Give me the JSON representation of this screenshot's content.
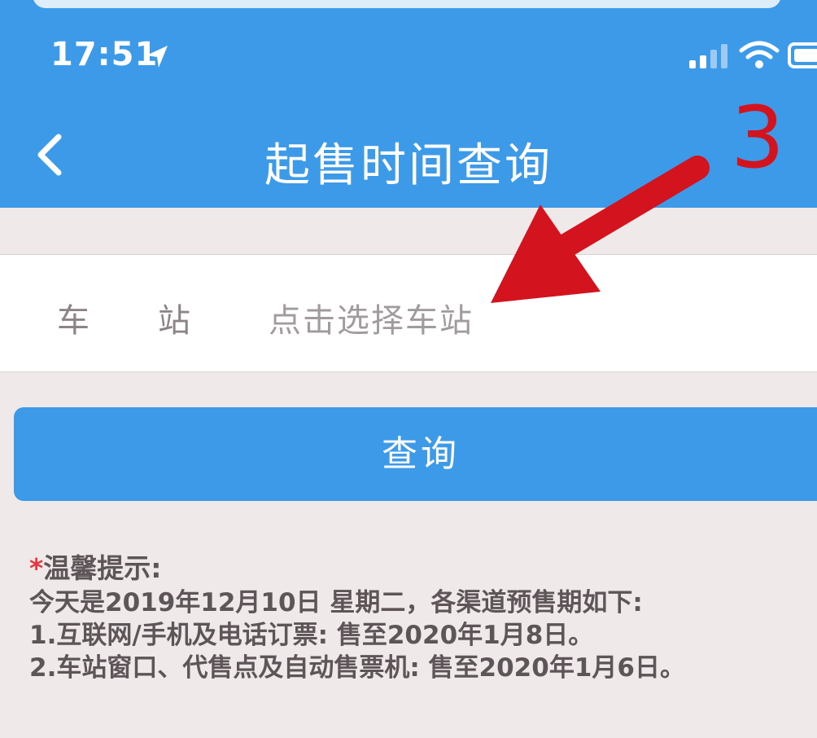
{
  "status_bar": {
    "time": "17:51"
  },
  "nav": {
    "title": "起售时间查询"
  },
  "station": {
    "label": "车站",
    "placeholder": "点击选择车站"
  },
  "query_button": {
    "label": "查询"
  },
  "tips": {
    "star": "*",
    "title": "温馨提示:",
    "lines": [
      "今天是2019年12月10日 星期二，各渠道预售期如下:",
      "1.互联网/手机及电话订票: 售至2020年1月8日。",
      "2.车站窗口、代售点及自动售票机: 售至2020年1月6日。"
    ]
  },
  "annotation": {
    "step_number": "3"
  },
  "colors": {
    "header_blue": "#3d9ae8",
    "page_background": "#efe9ea",
    "annotation_red": "#d3141f",
    "tips_star": "#e33842"
  }
}
